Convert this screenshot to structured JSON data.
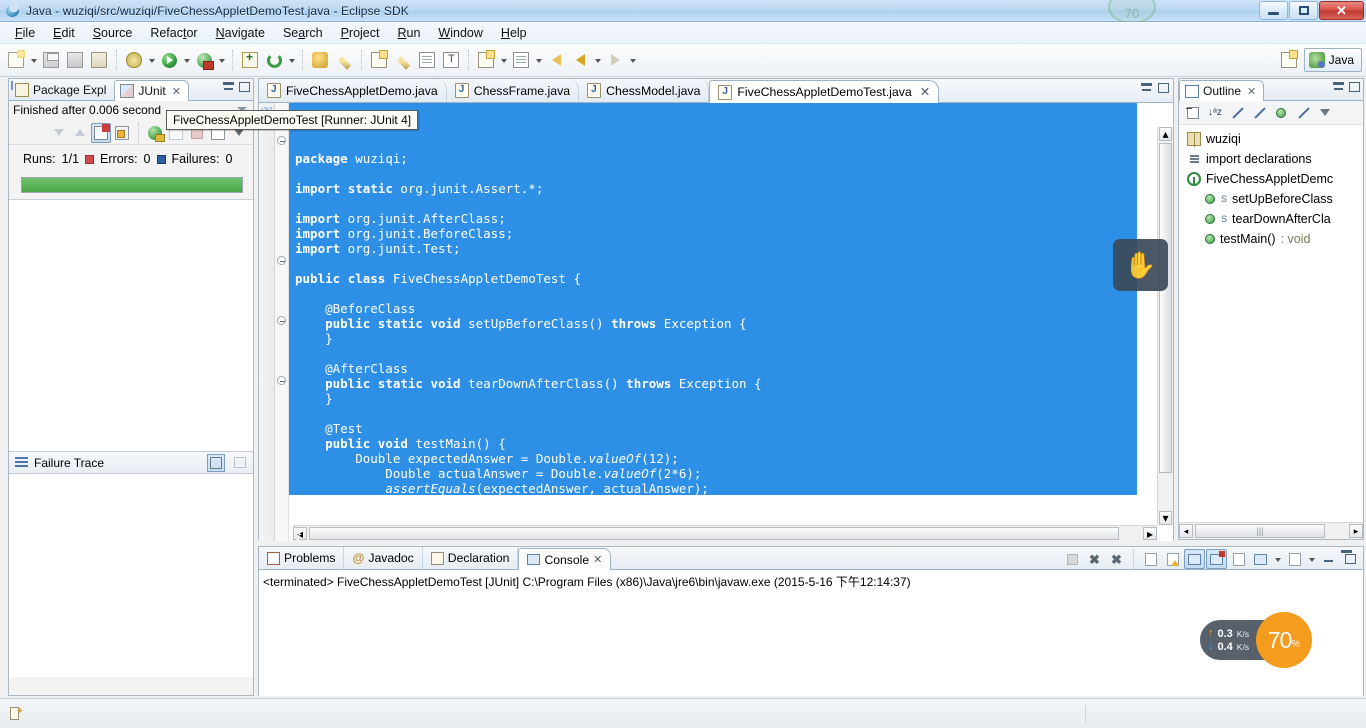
{
  "window": {
    "title": "Java - wuziqi/src/wuziqi/FiveChessAppletDemoTest.java - Eclipse SDK",
    "ghost_label": "70",
    "minimize_label": "Minimize",
    "maximize_label": "Maximize",
    "close_label": "Close"
  },
  "menubar": {
    "items": [
      {
        "label": "File",
        "mnemonic": "F"
      },
      {
        "label": "Edit",
        "mnemonic": "E"
      },
      {
        "label": "Source",
        "mnemonic": "S"
      },
      {
        "label": "Refactor",
        "mnemonic": "t"
      },
      {
        "label": "Navigate",
        "mnemonic": "N"
      },
      {
        "label": "Search",
        "mnemonic": "a"
      },
      {
        "label": "Project",
        "mnemonic": "P"
      },
      {
        "label": "Run",
        "mnemonic": "R"
      },
      {
        "label": "Window",
        "mnemonic": "W"
      },
      {
        "label": "Help",
        "mnemonic": "H"
      }
    ]
  },
  "toolbar": {
    "buttons": [
      "new-wizard",
      "save",
      "save-all",
      "print",
      "debug",
      "run",
      "run-external-tools",
      "new-java-class",
      "open-type",
      "search",
      "next-annotation",
      "previous-edit-location",
      "last-edit-location",
      "back",
      "forward"
    ]
  },
  "perspective": {
    "open_perspective_label": "Open Perspective",
    "current_label": "Java"
  },
  "junit": {
    "tabs": [
      {
        "label": "Package Expl",
        "active": false
      },
      {
        "label": "JUnit",
        "active": true
      }
    ],
    "status_text": "Finished after 0.006 second",
    "runs_label": "Runs:",
    "runs_value": "1/1",
    "errors_label": "Errors:",
    "errors_value": "0",
    "failures_label": "Failures:",
    "failures_value": "0",
    "progress_percent": 100,
    "progress_color": "#4aa44a",
    "failure_trace_label": "Failure Trace",
    "toolbar_buttons": [
      "next-failure",
      "previous-failure",
      "show-failures-only",
      "scroll-lock",
      "rerun-test",
      "rerun-failed-tests",
      "stop-test-run",
      "test-run-history",
      "view-menu"
    ]
  },
  "tooltip": {
    "text": "FiveChessAppletDemoTest [Runner: JUnit 4]"
  },
  "editor": {
    "tabs": [
      {
        "label": "FiveChessAppletDemo.java",
        "active": false
      },
      {
        "label": "ChessFrame.java",
        "active": false
      },
      {
        "label": "ChessModel.java",
        "active": false
      },
      {
        "label": "FiveChessAppletDemoTest.java",
        "active": true
      }
    ],
    "code_lines": [
      "package wuziqi;",
      "",
      "import static org.junit.Assert.*;",
      "",
      "import org.junit.AfterClass;",
      "import org.junit.BeforeClass;",
      "import org.junit.Test;",
      "",
      "public class FiveChessAppletDemoTest {",
      "",
      "    @BeforeClass",
      "    public static void setUpBeforeClass() throws Exception {",
      "    }",
      "",
      "    @AfterClass",
      "    public static void tearDownAfterClass() throws Exception {",
      "    }",
      "",
      "    @Test",
      "    public void testMain() {",
      "        Double expectedAnswer = Double.valueOf(12);",
      "            Double actualAnswer = Double.valueOf(2*6);",
      "            assertEquals(expectedAnswer, actualAnswer);",
      "    }",
      "",
      "}"
    ],
    "selection_color": "#2d8fe5",
    "cursor_icon": "grab-hand-cursor"
  },
  "outline": {
    "tab_label": "Outline",
    "toolbar_buttons": [
      "collapse-all",
      "sort-alphabetically",
      "hide-fields",
      "hide-static-fields",
      "hide-non-public-members",
      "hide-local-types",
      "view-menu"
    ],
    "items": [
      {
        "label": "wuziqi",
        "icon": "package-icon",
        "indent": 0,
        "modifier": "",
        "type": ""
      },
      {
        "label": "import declarations",
        "icon": "imports-icon",
        "indent": 0,
        "modifier": "",
        "type": ""
      },
      {
        "label": "FiveChessAppletDemc",
        "icon": "class-icon",
        "indent": 0,
        "modifier": "",
        "type": ""
      },
      {
        "label": "setUpBeforeClass",
        "icon": "method-icon",
        "indent": 1,
        "modifier": "S",
        "type": ""
      },
      {
        "label": "tearDownAfterCla",
        "icon": "method-icon",
        "indent": 1,
        "modifier": "S",
        "type": ""
      },
      {
        "label": "testMain()",
        "icon": "method-icon",
        "indent": 1,
        "modifier": "",
        "type": " : void"
      }
    ]
  },
  "console": {
    "tabs": [
      {
        "label": "Problems",
        "icon": "problems-icon",
        "active": false
      },
      {
        "label": "Javadoc",
        "icon": "javadoc-icon",
        "active": false
      },
      {
        "label": "Declaration",
        "icon": "declaration-icon",
        "active": false
      },
      {
        "label": "Console",
        "icon": "console-icon",
        "active": true
      }
    ],
    "output_line": "<terminated> FiveChessAppletDemoTest [JUnit] C:\\Program Files (x86)\\Java\\jre6\\bin\\javaw.exe (2015-5-16 下午12:14:37)",
    "toolbar_buttons": [
      "terminate",
      "remove-launch",
      "remove-all-terminated",
      "clear-console",
      "scroll-lock",
      "show-console-when-output-changes",
      "pin-console",
      "display-selected-console",
      "open-console",
      "minimize",
      "maximize"
    ]
  },
  "statusbar": {
    "icon": "writable-indicator"
  },
  "network_widget": {
    "upload_value": "0.3",
    "upload_unit": "K/s",
    "download_value": "0.4",
    "download_unit": "K/s",
    "percent_value": "70",
    "percent_symbol": "%",
    "accent_color": "#f59b1e"
  }
}
